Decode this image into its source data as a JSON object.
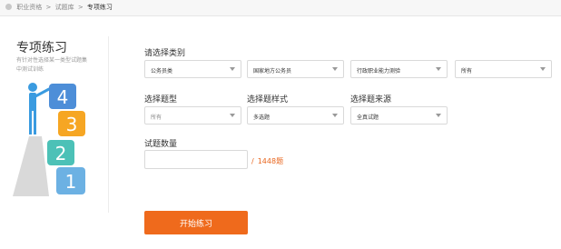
{
  "breadcrumb": {
    "home": "职业资格",
    "level2": "试题库",
    "current": "专项练习",
    "separator": ">"
  },
  "sidebar": {
    "title": "专项练习",
    "description": "有针对性选择某一类型试题集中测试训练"
  },
  "illustration": {
    "blocks": [
      "1",
      "2",
      "3",
      "4"
    ],
    "colors": {
      "one": "#6cb1e3",
      "two": "#4cc1b7",
      "three": "#f6a623",
      "four": "#4d8ed8",
      "pedestal": "#d9d9d9",
      "figure": "#3a9be0"
    }
  },
  "form": {
    "category_label": "请选择类别",
    "category_selects": [
      {
        "value": "公务员类"
      },
      {
        "value": "国家地方公务员"
      },
      {
        "value": "行政职业能力测验"
      },
      {
        "value": "所有"
      }
    ],
    "type_label": "选择题型",
    "type_value": "所有",
    "style_label": "选择题样式",
    "style_value": "多选题",
    "source_label": "选择题来源",
    "source_value": "全真试题",
    "count_label": "试题数量",
    "count_value": "",
    "total_slash": "/",
    "total_text": "1448题"
  },
  "actions": {
    "start_label": "开始练习"
  },
  "colors": {
    "accent": "#ef6a1c",
    "count_text": "#e8661e"
  }
}
